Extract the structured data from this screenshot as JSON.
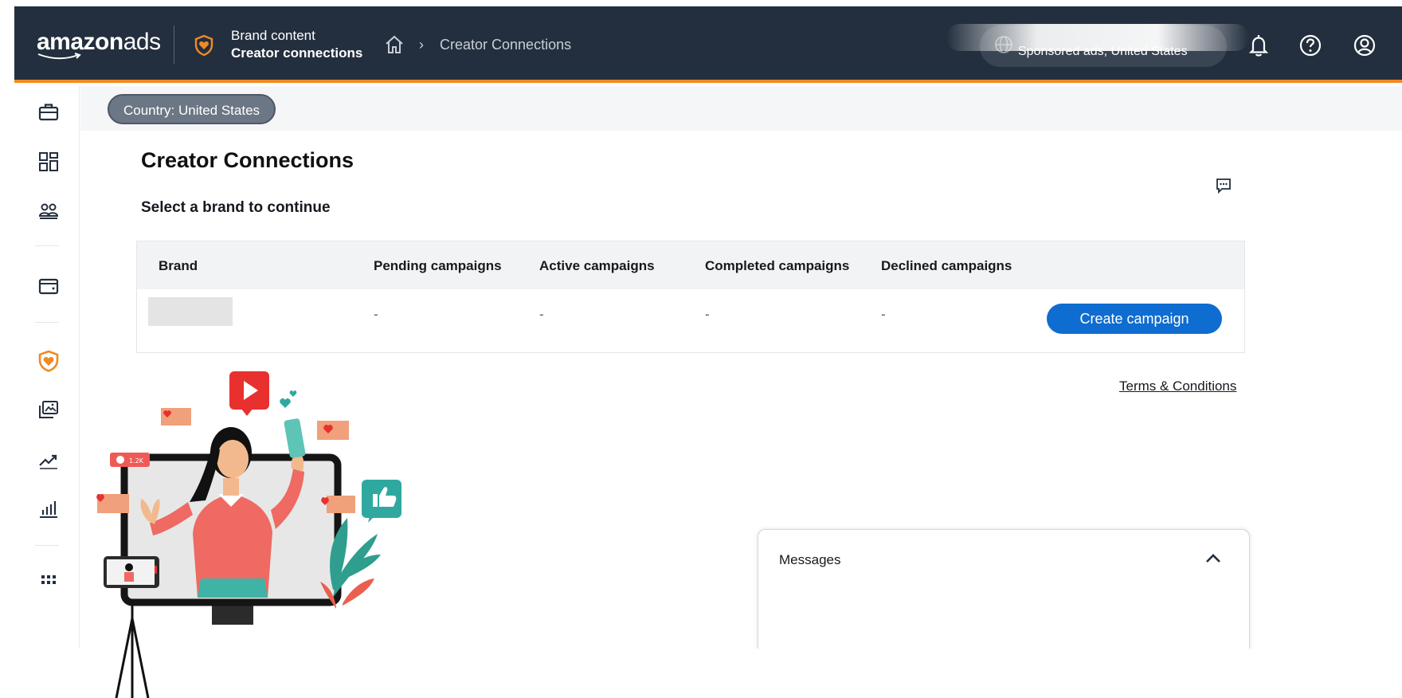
{
  "header": {
    "logo_brand": "amazon",
    "logo_ads": "ads",
    "section_label": "Brand content",
    "section_name": "Creator connections",
    "breadcrumb_separator": "›",
    "breadcrumb_current": "Creator Connections",
    "account_scope": "Sponsored ads, United States",
    "icons": [
      "bell-icon",
      "help-icon",
      "user-circle-icon",
      "home-icon",
      "globe-icon",
      "shield-heart-icon"
    ]
  },
  "sidebar": {
    "items": [
      {
        "icon": "briefcase-icon"
      },
      {
        "icon": "dashboard-icon"
      },
      {
        "icon": "audiences-icon"
      },
      {
        "icon": "wallet-icon"
      },
      {
        "icon": "shield-heart-icon",
        "active": true
      },
      {
        "icon": "media-library-icon"
      },
      {
        "icon": "trend-icon"
      },
      {
        "icon": "bar-chart-icon"
      },
      {
        "icon": "apps-grid-icon"
      }
    ],
    "accent_color": "#f08a24"
  },
  "country_filter": "Country: United States",
  "page": {
    "title": "Creator Connections",
    "subtitle": "Select a brand to continue"
  },
  "table": {
    "columns": [
      "Brand",
      "Pending campaigns",
      "Active campaigns",
      "Completed campaigns",
      "Declined campaigns"
    ],
    "rows": [
      {
        "brand": "",
        "pending": "-",
        "active": "-",
        "completed": "-",
        "declined": "-",
        "action": "Create campaign"
      }
    ]
  },
  "terms_link": "Terms & Conditions",
  "messages": {
    "title": "Messages"
  },
  "illustration": {
    "badge_count": "1.2K"
  },
  "colors": {
    "topbar": "#232f3e",
    "primary_button": "#0f6cd0",
    "accent": "#f08a24"
  }
}
